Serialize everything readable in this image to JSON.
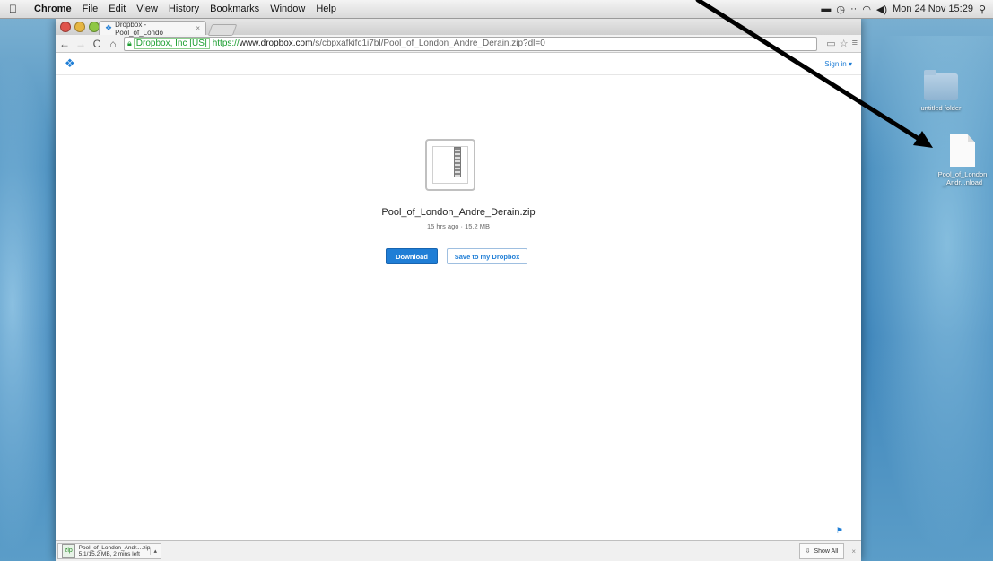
{
  "menubar": {
    "app_name": "Chrome",
    "menus": [
      "File",
      "Edit",
      "View",
      "History",
      "Bookmarks",
      "Window",
      "Help"
    ],
    "clock": "Mon 24 Nov  15:29"
  },
  "browser": {
    "tab_title": "Dropbox - Pool_of_Londo",
    "tab_close": "×",
    "url_ev": "Dropbox, Inc [US]",
    "url_scheme": "https://",
    "url_host": "www.dropbox.com",
    "url_path": "/s/cbpxafkifc1i7bl/Pool_of_London_Andre_Derain.zip?dl=0"
  },
  "page": {
    "signin": "Sign in ▾",
    "filename": "Pool_of_London_Andre_Derain.zip",
    "meta": "15 hrs ago · 15.2 MB",
    "download_label": "Download",
    "save_label": "Save to my Dropbox"
  },
  "download_bar": {
    "item_name": "Pool_of_London_Andr....zip",
    "item_status": "5.1/15.2 MB, 2 mins left",
    "show_all": "Show All",
    "close": "×"
  },
  "desktop": {
    "folder_label": "untitled folder",
    "file_label_line1": "Pool_of_London",
    "file_label_line2": "_Andr...nload"
  }
}
